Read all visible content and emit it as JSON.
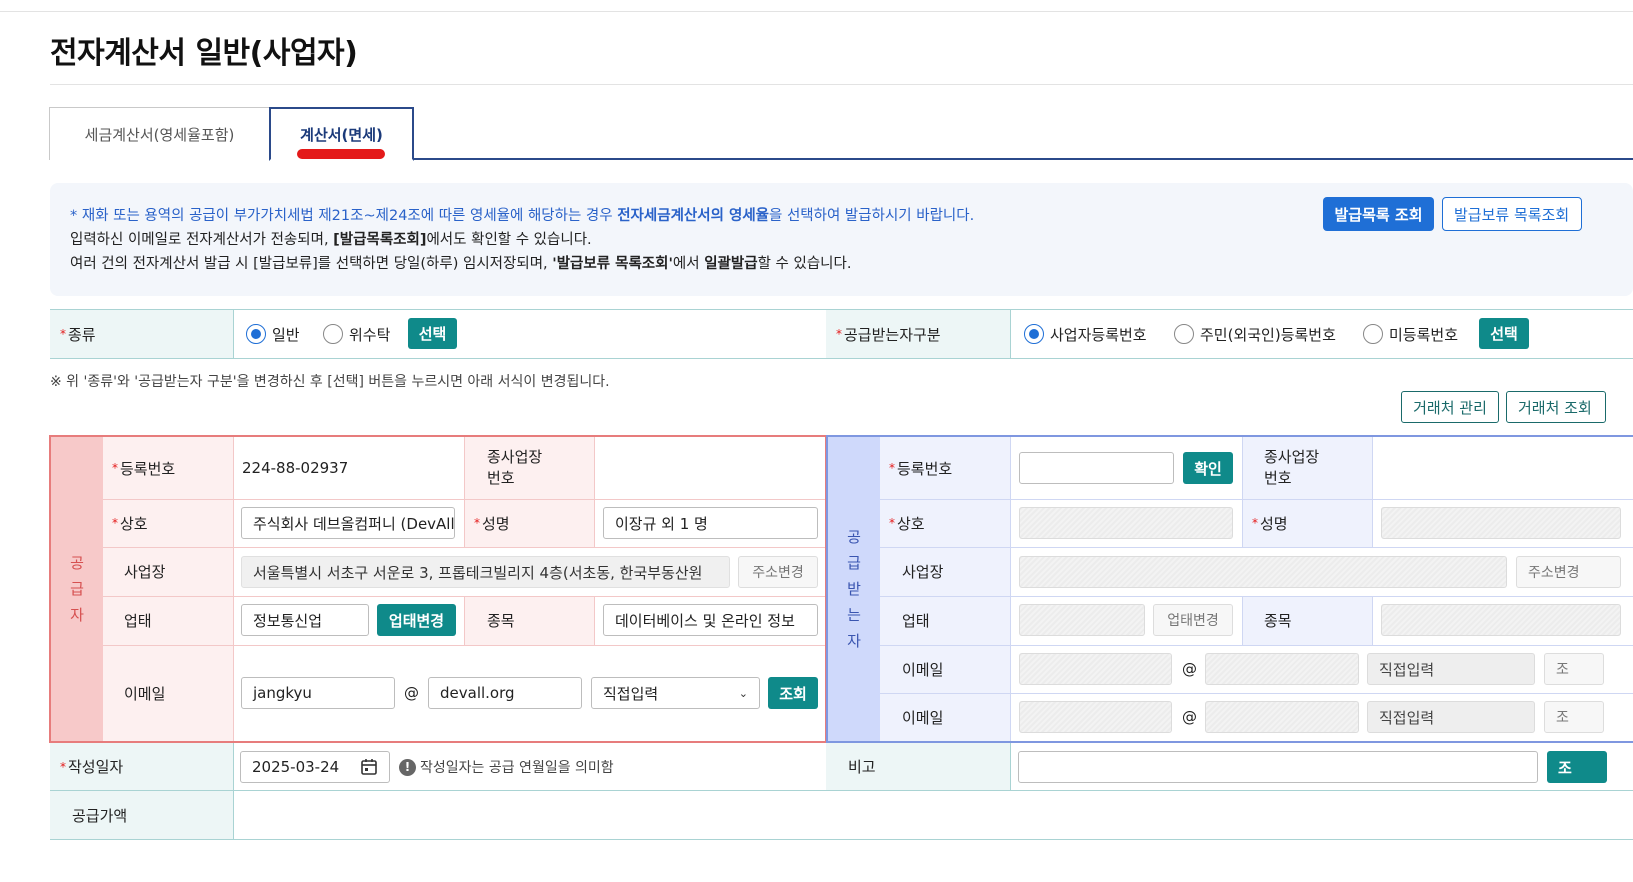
{
  "page_title": "전자계산서 일반(사업자)",
  "tabs": [
    {
      "label": "세금계산서(영세율포함)",
      "active": false
    },
    {
      "label": "계산서(면세)",
      "active": true
    }
  ],
  "notice": {
    "line1_pre": "* 재화 또는 용역의 공급이 부가가치세법 제21조~제24조에 따른 영세율에 해당하는 경우 ",
    "line1_bold": "전자세금계산서의 영세율",
    "line1_post": "을 선택하여 발급하시기 바랍니다.",
    "line2_pre": "입력하신 이메일로 전자계산서가 전송되며, ",
    "line2_bold": "[발급목록조회]",
    "line2_post": "에서도 확인할 수 있습니다.",
    "line3_pre": "여러 건의 전자계산서 발급 시 [발급보류]를 선택하면 당일(하루) 임시저장되며, ",
    "line3_bold1": "'발급보류 목록조회'",
    "line3_mid": "에서 ",
    "line3_bold2": "일괄발급",
    "line3_post": "할 수 있습니다."
  },
  "buttons": {
    "issue_list": "발급목록 조회",
    "hold_list": "발급보류 목록조회",
    "select": "선택",
    "client_manage": "거래처 관리",
    "client_lookup": "거래처 조회",
    "confirm": "확인",
    "change_address": "주소변경",
    "change_business": "업태변경",
    "lookup": "조회"
  },
  "type_row": {
    "label": "종류",
    "options": [
      "일반",
      "위수탁"
    ],
    "selected": "일반",
    "receiver_type_label": "공급받는자구분",
    "receiver_options": [
      "사업자등록번호",
      "주민(외국인)등록번호",
      "미등록번호"
    ],
    "receiver_selected": "사업자등록번호"
  },
  "change_note": "※ 위 '종류'와 '공급받는자 구분'을 변경하신 후 [선택] 버튼을 누르시면 아래 서식이 변경됩니다.",
  "supplier": {
    "side_label": "공\n급\n자",
    "labels": {
      "reg_no": "등록번호",
      "branch_no": "종사업장\n번호",
      "company": "상호",
      "name": "성명",
      "address": "사업장",
      "business_type": "업태",
      "item": "종목",
      "email": "이메일"
    },
    "reg_no": "224-88-02937",
    "company": "주식회사 데브올컴퍼니 (DevAll",
    "name": "이장규 외 1 명",
    "address": "서울특별시 서초구 서운로 3, 프롭테크빌리지 4층(서초동, 한국부동산원",
    "business_type": "정보통신업",
    "item": "데이터베이스 및 온라인 정보",
    "email_id": "jangkyu",
    "email_at": "@",
    "email_domain": "devall.org",
    "email_domain_select": "직접입력"
  },
  "receiver": {
    "side_label": "공\n급\n받\n는\n자",
    "labels": {
      "reg_no": "등록번호",
      "branch_no": "종사업장\n번호",
      "company": "상호",
      "name": "성명",
      "address": "사업장",
      "business_type": "업태",
      "item": "종목",
      "email1": "이메일",
      "email2": "이메일"
    },
    "email_at": "@",
    "email_select1": "직접입력",
    "email_select2": "직접입력",
    "lookup_short": "조"
  },
  "bottom": {
    "date_label": "작성일자",
    "date_value": "2025-03-24",
    "date_hint": "작성일자는 공급 연월일을 의미함",
    "remark_label": "비고",
    "supply_label": "공급가액"
  },
  "colors": {
    "supplier_side": "#f7c9c9",
    "supplier_label": "#fdf0f0",
    "supplier_border": "#e77c7c",
    "receiver_side": "#cfd9fb",
    "receiver_label": "#eff2fd",
    "receiver_border": "#7f97e0",
    "teal": "#0f8a8a",
    "blue": "#1f6fd6",
    "type_row_bg": "#edf6f6"
  }
}
